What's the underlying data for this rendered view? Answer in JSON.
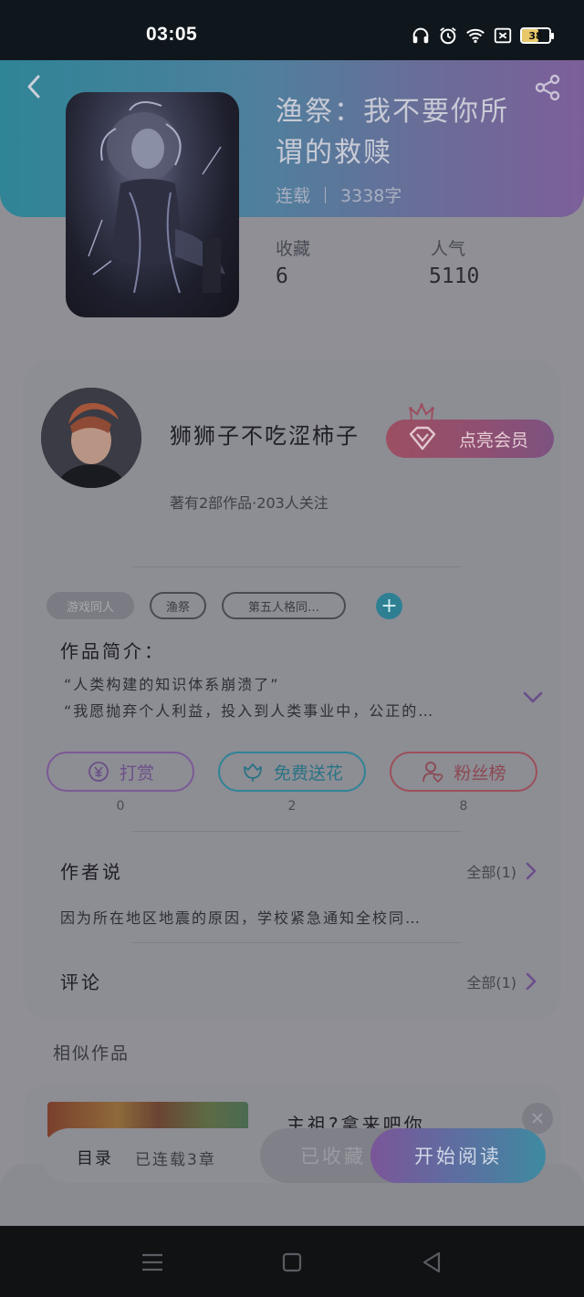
{
  "status_bar": {
    "time": "03:05",
    "battery": "38",
    "icons": [
      "headphones-icon",
      "alarm-icon",
      "wifi-icon",
      "sim-off-icon",
      "battery-icon"
    ]
  },
  "header": {
    "back_icon": "chevron-left-icon",
    "share_icon": "share-icon",
    "title": "渔祭：我不要你所谓的救赎",
    "status": "连载",
    "word_count": "3338字",
    "gradient": [
      "#2f8496",
      "#7c5f99"
    ]
  },
  "stats": {
    "favorites_label": "收藏",
    "favorites_value": "6",
    "popularity_label": "人气",
    "popularity_value": "5110"
  },
  "author": {
    "name": "狮狮子不吃涩柿子",
    "stats": "著有2部作品·203人关注",
    "vip_button": "点亮会员"
  },
  "tags": [
    "游戏同人",
    "渔祭",
    "第五人格同…"
  ],
  "intro": {
    "title": "作品简介：",
    "line1": "“人类构建的知识体系崩溃了”",
    "line2": "“我愿抛弃个人利益，投入到人类事业中，公正的…"
  },
  "actions": [
    {
      "label": "打赏",
      "count": "0",
      "color": "#7b5a96"
    },
    {
      "label": "免费送花",
      "count": "2",
      "color": "#2f8496"
    },
    {
      "label": "粉丝榜",
      "count": "8",
      "color": "#9c4f5a"
    }
  ],
  "author_says": {
    "title": "作者说",
    "more": "全部(1)",
    "text": "因为所在地区地震的原因，学校紧急通知全校同…"
  },
  "comments": {
    "title": "评论",
    "more": "全部(1)"
  },
  "similar": {
    "title": "相似作品",
    "book_title": "主祖?拿来吧你"
  },
  "bottom_bar": {
    "catalog": "目录",
    "chapters": "已连载3章",
    "collected": "已收藏",
    "read": "开始阅读"
  },
  "accent_colors": {
    "purple": "#7b5a96",
    "teal": "#2f8496",
    "red": "#9c4f5a"
  }
}
